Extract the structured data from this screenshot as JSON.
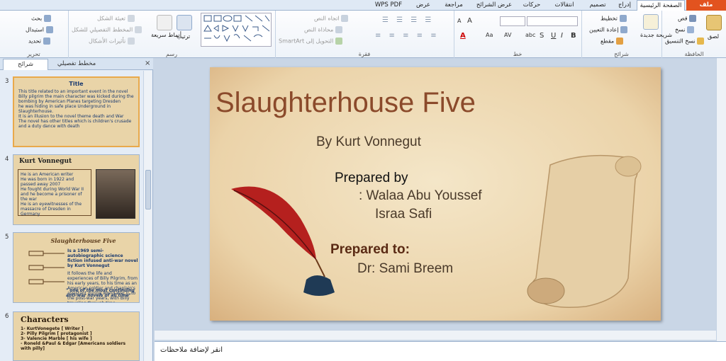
{
  "tabs": [
    "ملف",
    "الصفحة الرئيسية",
    "إدراج",
    "تصميم",
    "انتقالات",
    "حركات",
    "عرض الشرائح",
    "مراجعة",
    "عرض",
    "WPS PDF"
  ],
  "ribbon": {
    "clipboard": {
      "label": "الحافظة",
      "paste": "لصق",
      "cut": "قص",
      "copy": "نسخ",
      "format_painter": "نسخ التنسيق"
    },
    "slides": {
      "label": "شرائح",
      "new_slide": "شريحة جديدة",
      "layout": "تخطيط",
      "reset": "إعادة التعيين",
      "section": "مقطع"
    },
    "font": {
      "label": "خط"
    },
    "paragraph": {
      "label": "فقرة",
      "text_direction": "اتجاه النص",
      "align_text": "محاذاة النص",
      "smartart": "التحويل إلى SmartArt"
    },
    "drawing": {
      "label": "رسم",
      "arrange": "ترتيب",
      "quick_styles": "أنماط سريعة",
      "shape_fill": "تعبئة الشكل",
      "shape_outline": "المخطط التفصيلي للشكل",
      "shape_effects": "تأثيرات الأشكال"
    },
    "editing": {
      "label": "تحرير",
      "find": "بحث",
      "replace": "استبدال",
      "select": "تحديد"
    }
  },
  "pane": {
    "tab_slides": "شرائح",
    "tab_outline": "مخطط تفصيلي",
    "close": "×",
    "slides": [
      {
        "number": "3",
        "title": "Title",
        "lines": [
          "This title related to an important event in the novel",
          "Billy pilgrim the main character was kicked during the bombing by American Planes targeting Dresden",
          "he was hiding in safe place Underground in Slaughterhouse.",
          "It is an illusion to the novel theme death and War",
          "The novel has other titles which is children's crusade and a duty dance with death"
        ]
      },
      {
        "number": "4",
        "title": "Kurt Vonnegut",
        "lines": [
          "He is an American writer",
          "He was born in 1922 and passed away 2007",
          "He fought during World War II and he become a prisoner of the war",
          "He is an eyewitnesses of the massacre of Dresden in Germany"
        ]
      },
      {
        "number": "5",
        "title": "Slaughterhouse Five",
        "lines": [
          "Is a 1969 semi-autobiographic science fiction infused anti-war novel by Kurt Vonnegut",
          "It follows the life and experiences of Billy Pilgrim, from his early years, to his time as an American soldier and chaplain's assistant during World War II, to the post-war years, with Billy traveling through time.",
          "\" one of the most continuing anti-war novels of all time\""
        ]
      },
      {
        "number": "6",
        "title": "Characters",
        "lines": [
          "1- KurtVonegete [ Writer ]",
          "2- Pilly Pilgrim [ protagonist ]",
          "3- Valencie Marble [ his wife ]",
          "- Roneld &Paul & Edgar [Americans soldiers with pilly]"
        ]
      }
    ]
  },
  "slide": {
    "title": "Slaughterhouse  Five",
    "author": "By Kurt Vonnegut",
    "prepared_by": "Prepared  by",
    "name1": ": Walaa Abu Youssef",
    "name2": "Israa Safi",
    "prepared_to": "Prepared to:",
    "doctor": "Dr: Sami Breem"
  },
  "notes": {
    "placeholder": "انقر لإضافة ملاحظات"
  },
  "colors": {
    "file_tab": "#e2531f",
    "title": "#8b4a2b",
    "accent_border": "#e9a94b"
  }
}
